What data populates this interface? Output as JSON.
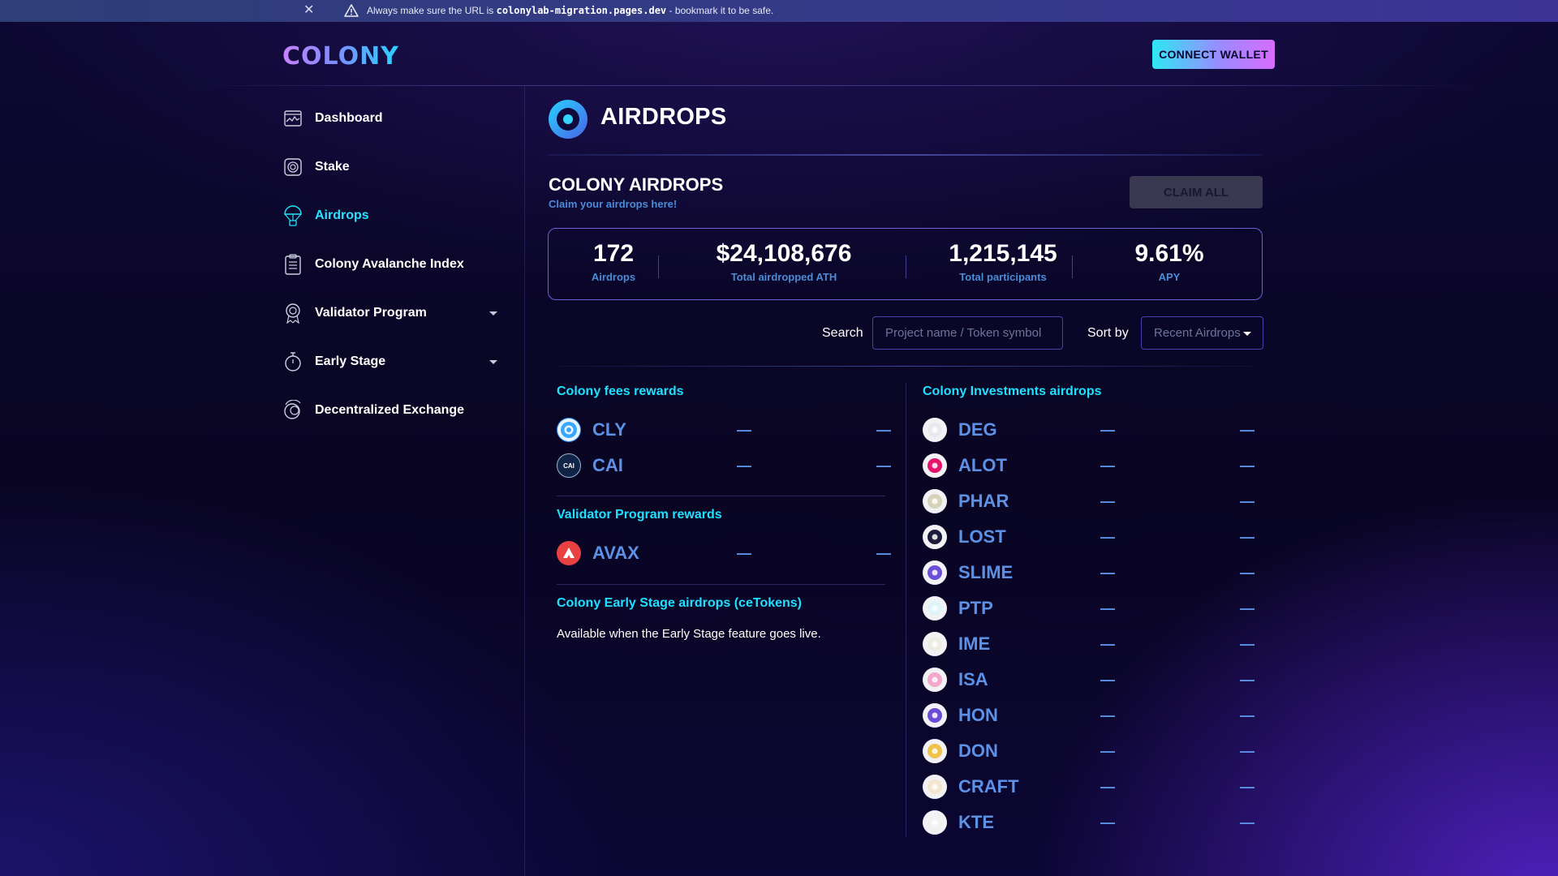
{
  "banner": {
    "close_glyph": "✕",
    "prefix": "Always make sure the URL is",
    "url": "colonylab-migration.pages.dev",
    "suffix": "- bookmark it to be safe."
  },
  "header": {
    "logo_text": "COLONY",
    "connect_wallet": "CONNECT WALLET"
  },
  "sidebar": {
    "items": [
      {
        "label": "Dashboard",
        "icon": "dashboard-icon"
      },
      {
        "label": "Stake",
        "icon": "stake-icon"
      },
      {
        "label": "Airdrops",
        "icon": "airdrops-icon",
        "active": true
      },
      {
        "label": "Colony Avalanche Index",
        "icon": "clipboard-icon"
      },
      {
        "label": "Validator Program",
        "icon": "badge-icon",
        "expandable": true
      },
      {
        "label": "Early Stage",
        "icon": "stopwatch-icon",
        "expandable": true
      },
      {
        "label": "Decentralized Exchange",
        "icon": "exchange-icon"
      }
    ]
  },
  "page": {
    "title": "AIRDROPS",
    "section_title": "COLONY AIRDROPS",
    "section_subtitle": "Claim your airdrops here!",
    "claim_all": "CLAIM ALL"
  },
  "stats": [
    {
      "value": "172",
      "label": "Airdrops"
    },
    {
      "value": "$24,108,676",
      "label": "Total airdropped ATH"
    },
    {
      "value": "1,215,145",
      "label": "Total participants"
    },
    {
      "value": "9.61%",
      "label": "APY"
    }
  ],
  "filters": {
    "search_label": "Search",
    "search_placeholder": "Project name / Token symbol",
    "sort_label": "Sort by",
    "sort_value": "Recent Airdrops"
  },
  "groups": {
    "fees": {
      "title": "Colony fees rewards",
      "tokens": [
        {
          "symbol": "CLY",
          "col1": "—",
          "col2": "—",
          "color": "#3aa7ff"
        },
        {
          "symbol": "CAI",
          "col1": "—",
          "col2": "—",
          "color": "#0f2446",
          "logo_text": "CAI"
        }
      ]
    },
    "validator": {
      "title": "Validator Program rewards",
      "tokens": [
        {
          "symbol": "AVAX",
          "col1": "—",
          "col2": "—",
          "color": "#e84142"
        }
      ]
    },
    "early": {
      "title": "Colony Early Stage airdrops (ceTokens)",
      "note": "Available when the Early Stage feature goes live."
    },
    "investments": {
      "title": "Colony Investments airdrops",
      "tokens": [
        {
          "symbol": "DEG",
          "col1": "—",
          "col2": "—",
          "color": "#e8e8ee"
        },
        {
          "symbol": "ALOT",
          "col1": "—",
          "col2": "—",
          "color": "#e6136c"
        },
        {
          "symbol": "PHAR",
          "col1": "—",
          "col2": "—",
          "color": "#d8d2b8"
        },
        {
          "symbol": "LOST",
          "col1": "—",
          "col2": "—",
          "color": "#1c1c3a"
        },
        {
          "symbol": "SLIME",
          "col1": "—",
          "col2": "—",
          "color": "#6b4fd8"
        },
        {
          "symbol": "PTP",
          "col1": "—",
          "col2": "—",
          "color": "#dff5f7"
        },
        {
          "symbol": "IME",
          "col1": "—",
          "col2": "—",
          "color": "#efece4"
        },
        {
          "symbol": "ISA",
          "col1": "—",
          "col2": "—",
          "color": "#f4a7c8"
        },
        {
          "symbol": "HON",
          "col1": "—",
          "col2": "—",
          "color": "#6c4bd6"
        },
        {
          "symbol": "DON",
          "col1": "—",
          "col2": "—",
          "color": "#f0c24a"
        },
        {
          "symbol": "CRAFT",
          "col1": "—",
          "col2": "—",
          "color": "#f5e6d0"
        },
        {
          "symbol": "KTE",
          "col1": "—",
          "col2": "—",
          "color": "#f2f2f2"
        }
      ]
    }
  }
}
